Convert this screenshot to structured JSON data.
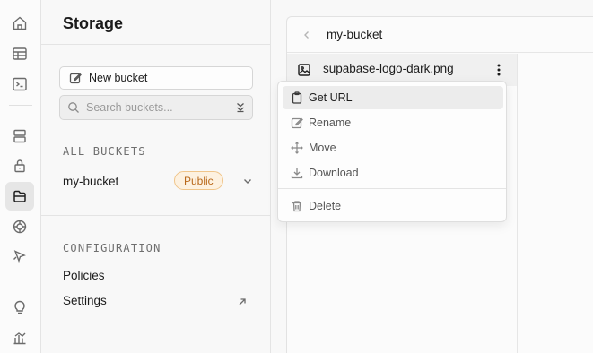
{
  "sidebar": {
    "title": "Storage",
    "new_bucket_label": "New bucket",
    "search_placeholder": "Search buckets...",
    "all_buckets_heading": "ALL BUCKETS",
    "buckets": [
      {
        "name": "my-bucket",
        "badge": "Public"
      }
    ],
    "configuration_heading": "CONFIGURATION",
    "config_links": [
      "Policies",
      "Settings"
    ]
  },
  "explorer": {
    "path": "my-bucket",
    "file_name": "supabase-logo-dark.png"
  },
  "context_menu": {
    "items": [
      "Get URL",
      "Rename",
      "Move",
      "Download",
      "Delete"
    ],
    "highlighted": "Get URL"
  },
  "rail_icons": [
    "home-icon",
    "table-editor-icon",
    "sql-editor-icon",
    "database-icon",
    "auth-lock-icon",
    "storage-icon",
    "realtime-icon",
    "edge-functions-icon",
    "advisors-bulb-icon",
    "reports-icon"
  ],
  "colors": {
    "badge_bg": "#fdf1e0",
    "badge_border": "#f0c58a",
    "badge_text": "#b8681a",
    "active_rail_bg": "#e6e6e6"
  }
}
